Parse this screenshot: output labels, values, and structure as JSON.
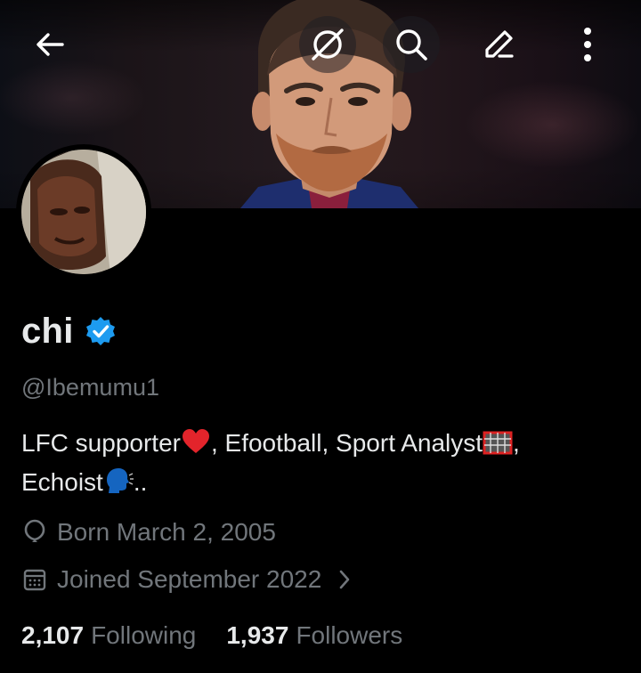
{
  "header": {
    "icons": [
      "back-arrow-icon",
      "grok-icon",
      "search-icon",
      "edit-icon",
      "more-vertical-icon"
    ]
  },
  "profile": {
    "display_name": "chi",
    "verified": true,
    "handle": "@Ibemumu1",
    "bio_line1_a": "LFC supporter",
    "bio_line1_b": ", Efootball, Sport Analyst",
    "bio_line1_c": ",",
    "bio_line2_a": "Echoist",
    "bio_line2_b": "..",
    "bio_emojis": [
      "red-heart-emoji",
      "goal-net-emoji",
      "speaking-head-emoji"
    ],
    "born": "Born March 2, 2005",
    "joined": "Joined September 2022"
  },
  "stats": {
    "following_count": "2,107",
    "following_label": "Following",
    "followers_count": "1,937",
    "followers_label": "Followers"
  },
  "colors": {
    "background": "#000000",
    "primary_text": "#e7e9ea",
    "secondary_text": "#71767b",
    "verified_blue": "#1d9bf0"
  }
}
